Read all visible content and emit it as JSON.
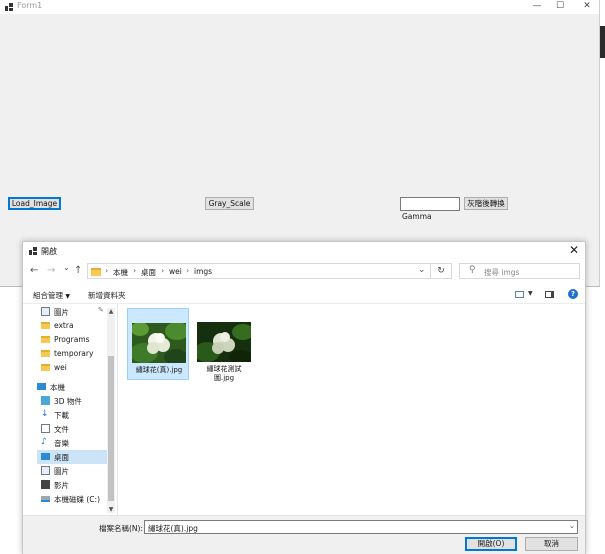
{
  "form": {
    "title": "Form1",
    "caption_buttons": {
      "minimize": "—",
      "maximize": "☐",
      "close": "✕"
    },
    "load_image_label": "Load_Image",
    "gray_scale_label": "Gray_Scale",
    "gamma_input_value": "",
    "gamma_button_label": "灰階後轉換",
    "gamma_label": "Gamma"
  },
  "dialog": {
    "title": "開啟",
    "close_glyph": "✕",
    "nav": {
      "back": "←",
      "forward": "→",
      "recent": "⌄",
      "up": "↑"
    },
    "breadcrumb": [
      "本機",
      "桌面",
      "wei",
      "imgs"
    ],
    "breadcrumb_sep": "›",
    "refresh_glyph": "↻",
    "search_placeholder": "搜尋 imgs",
    "organize_label": "組合管理",
    "new_folder_label": "新增資料夾",
    "nav_items": [
      {
        "label": "圖片",
        "icon": "pictures-icon",
        "pinned": true
      },
      {
        "label": "extra",
        "icon": "folder-icon"
      },
      {
        "label": "Programs",
        "icon": "folder-icon"
      },
      {
        "label": "temporary",
        "icon": "folder-icon"
      },
      {
        "label": "wei",
        "icon": "folder-icon"
      },
      {
        "label": "本機",
        "icon": "this-pc-icon"
      },
      {
        "label": "3D 物件",
        "icon": "3d-objects-icon"
      },
      {
        "label": "下載",
        "icon": "downloads-icon"
      },
      {
        "label": "文件",
        "icon": "documents-icon"
      },
      {
        "label": "音樂",
        "icon": "music-icon"
      },
      {
        "label": "桌面",
        "icon": "desktop-icon",
        "selected": true
      },
      {
        "label": "圖片",
        "icon": "pictures-icon"
      },
      {
        "label": "影片",
        "icon": "videos-icon"
      },
      {
        "label": "本機磁碟 (C:)",
        "icon": "local-disk-icon"
      }
    ],
    "files": [
      {
        "name": "繡球花(真).jpg",
        "selected": true
      },
      {
        "name": "繡球花測試圖.jpg",
        "selected": false
      }
    ],
    "filename_label": "檔案名稱(N):",
    "filename_value": "繡球花(真).jpg",
    "open_label": "開啟(O)",
    "cancel_label": "取消",
    "colors": {
      "accent": "#0078d7",
      "selection": "#cce8ff",
      "nav_selection": "#cce4f7"
    }
  }
}
